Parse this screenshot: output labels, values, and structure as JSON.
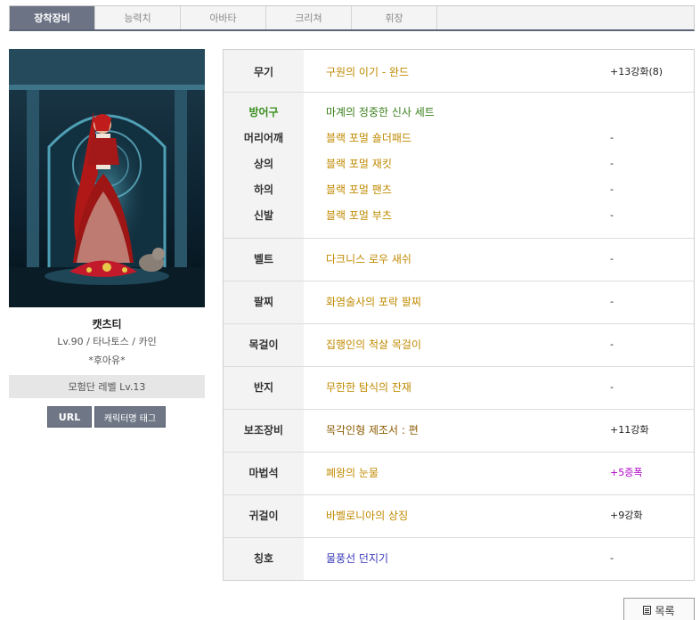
{
  "tabs": [
    {
      "label": "장착장비",
      "active": true
    },
    {
      "label": "능력치"
    },
    {
      "label": "아바타"
    },
    {
      "label": "크리쳐"
    },
    {
      "label": "휘장"
    }
  ],
  "character": {
    "name": "캣츠티",
    "info": "Lv.90 / 타나토스 / 카인",
    "guild": "*후아유*",
    "adventure_level": "모험단 레벨 Lv.13"
  },
  "buttons": {
    "url": "URL",
    "tag": "캐릭터명 태그",
    "list": "목록"
  },
  "equipment": {
    "weapon": {
      "label": "무기",
      "name": "구원의 이기 - 완드",
      "value": "+13강화(8)"
    },
    "armor_header": {
      "label": "방어구",
      "name": "마계의 정중한 신사 세트"
    },
    "shoulder": {
      "label": "머리어깨",
      "name": "블랙 포멀 숄더패드",
      "value": "-"
    },
    "top": {
      "label": "상의",
      "name": "블랙 포멀 재킷",
      "value": "-"
    },
    "bottom": {
      "label": "하의",
      "name": "블랙 포멀 팬츠",
      "value": "-"
    },
    "shoes": {
      "label": "신발",
      "name": "블랙 포멀 부츠",
      "value": "-"
    },
    "belt": {
      "label": "벨트",
      "name": "다크니스 로우 새쉬",
      "value": "-"
    },
    "bracelet": {
      "label": "팔찌",
      "name": "화염술사의 포락 팔찌",
      "value": "-"
    },
    "necklace": {
      "label": "목걸이",
      "name": "집행인의 척살 목걸이",
      "value": "-"
    },
    "ring": {
      "label": "반지",
      "name": "무한한 탐식의 잔재",
      "value": "-"
    },
    "support": {
      "label": "보조장비",
      "name": "목각인형 제조서 : 편",
      "value": "+11강화"
    },
    "magic_stone": {
      "label": "마법석",
      "name": "폐왕의 눈물",
      "value": "+5증폭"
    },
    "earring": {
      "label": "귀걸이",
      "name": "바벨로니아의 상징",
      "value": "+9강화"
    },
    "title": {
      "label": "칭호",
      "name": "물풍선 던지기",
      "value": "-"
    }
  },
  "colors": {
    "tab_active_bg": "#6b7385",
    "gold_item": "#c08a00",
    "green_item": "#3a7f1a",
    "purple_value": "#b000c8",
    "blue_item": "#3a3ab8"
  }
}
